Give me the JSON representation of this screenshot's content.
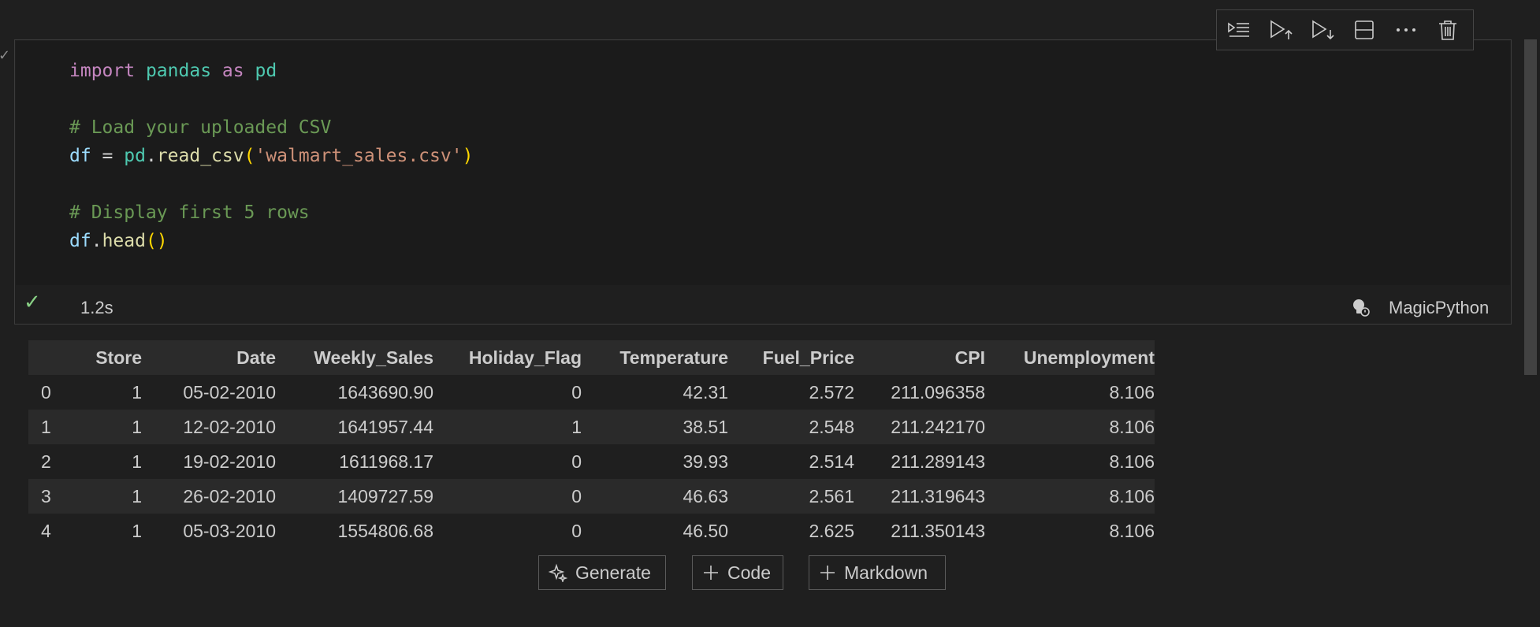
{
  "cell": {
    "code_lines": [
      [
        {
          "t": "import",
          "c": "kw"
        },
        {
          "t": " ",
          "c": "plain"
        },
        {
          "t": "pandas",
          "c": "mod"
        },
        {
          "t": " ",
          "c": "plain"
        },
        {
          "t": "as",
          "c": "kw"
        },
        {
          "t": " ",
          "c": "plain"
        },
        {
          "t": "pd",
          "c": "mod"
        }
      ],
      [],
      [
        {
          "t": "# Load your uploaded CSV",
          "c": "cmt"
        }
      ],
      [
        {
          "t": "df",
          "c": "var"
        },
        {
          "t": " = ",
          "c": "plain"
        },
        {
          "t": "pd",
          "c": "mod"
        },
        {
          "t": ".",
          "c": "plain"
        },
        {
          "t": "read_csv",
          "c": "fn"
        },
        {
          "t": "(",
          "c": "paren"
        },
        {
          "t": "'walmart_sales.csv'",
          "c": "str"
        },
        {
          "t": ")",
          "c": "paren"
        }
      ],
      [],
      [
        {
          "t": "# Display first 5 rows",
          "c": "cmt"
        }
      ],
      [
        {
          "t": "df",
          "c": "var"
        },
        {
          "t": ".",
          "c": "plain"
        },
        {
          "t": "head",
          "c": "fn"
        },
        {
          "t": "()",
          "c": "paren"
        }
      ]
    ],
    "exec_time": "1.2s",
    "kernel_name": "MagicPython",
    "toolbar_icons": [
      "run-above-icon",
      "run-cell-and-above-icon",
      "run-cell-and-below-icon",
      "split-cell-icon",
      "more-actions-icon",
      "delete-cell-icon"
    ]
  },
  "output_table": {
    "columns": [
      "",
      "Store",
      "Date",
      "Weekly_Sales",
      "Holiday_Flag",
      "Temperature",
      "Fuel_Price",
      "CPI",
      "Unemployment"
    ],
    "rows": [
      [
        "0",
        "1",
        "05-02-2010",
        "1643690.90",
        "0",
        "42.31",
        "2.572",
        "211.096358",
        "8.106"
      ],
      [
        "1",
        "1",
        "12-02-2010",
        "1641957.44",
        "1",
        "38.51",
        "2.548",
        "211.242170",
        "8.106"
      ],
      [
        "2",
        "1",
        "19-02-2010",
        "1611968.17",
        "0",
        "39.93",
        "2.514",
        "211.289143",
        "8.106"
      ],
      [
        "3",
        "1",
        "26-02-2010",
        "1409727.59",
        "0",
        "46.63",
        "2.561",
        "211.319643",
        "8.106"
      ],
      [
        "4",
        "1",
        "05-03-2010",
        "1554806.68",
        "0",
        "46.50",
        "2.625",
        "211.350143",
        "8.106"
      ]
    ]
  },
  "add_cell": {
    "generate_label": "Generate",
    "code_label": "Code",
    "markdown_label": "Markdown"
  },
  "colors": {
    "background": "#1f1f1f",
    "success": "#89d185",
    "border": "#3c3c3c"
  }
}
